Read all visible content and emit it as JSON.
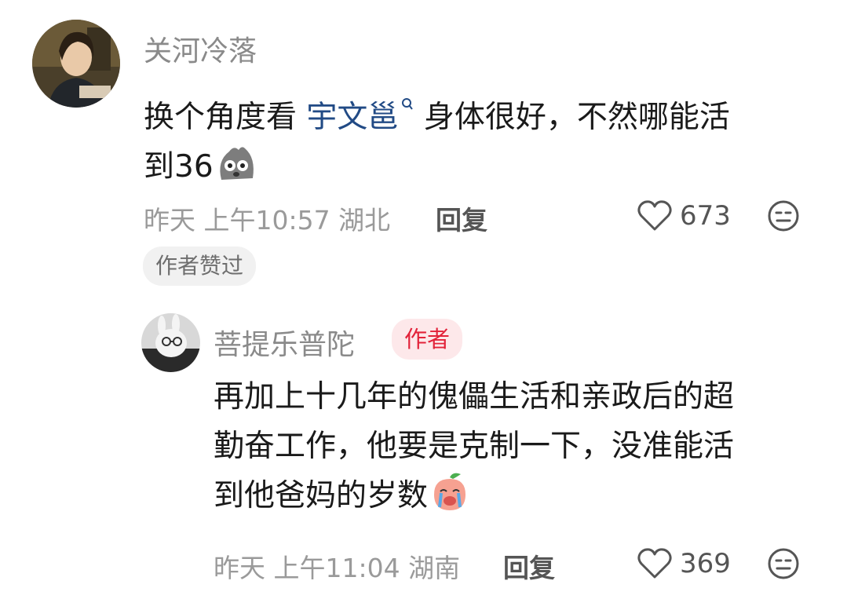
{
  "comments": [
    {
      "username": "关河冷落",
      "text_prefix": "换个角度看 ",
      "link_text": "宇文邕",
      "text_rest_line1": " 身体很好，不然哪能活",
      "text_line2": "到36",
      "emoji_icon": "pig-face-emoji-icon",
      "time": "昨天 上午10:57 湖北",
      "reply_label": "回复",
      "likes": "673",
      "liked_by_author_label": "作者赞过"
    },
    {
      "username": "菩提乐普陀",
      "author_tag": "作者",
      "text_line1": "再加上十几年的傀儡生活和亲政后的超",
      "text_line2": "勤奋工作，他要是克制一下，没准能活",
      "text_line3": "到他爸妈的岁数",
      "emoji_icon": "crying-peach-emoji-icon",
      "time": "昨天 上午11:04 湖南",
      "reply_label": "回复",
      "likes": "369"
    }
  ],
  "colors": {
    "link": "#214a85",
    "author_tag_text": "#e2233a",
    "author_tag_bg": "#fde8ea",
    "muted": "#9a9a9a"
  }
}
